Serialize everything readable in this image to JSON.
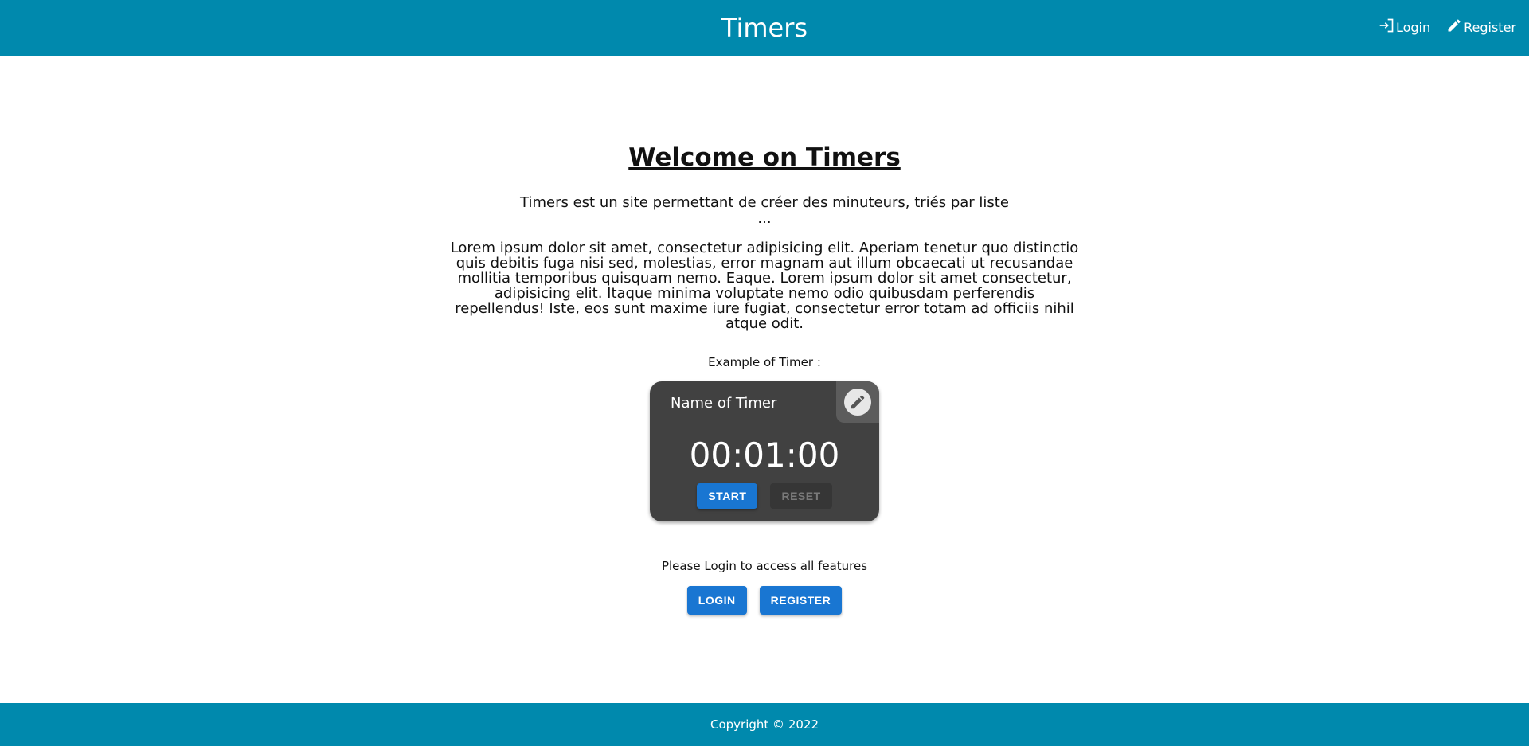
{
  "header": {
    "title": "Timers",
    "login_label": "Login",
    "register_label": "Register"
  },
  "main": {
    "welcome_title": "Welcome on Timers",
    "intro_line": "Timers est un site permettant de créer des minuteurs, triés par liste",
    "intro_ellipsis": "...",
    "lorem": "Lorem ipsum dolor sit amet, consectetur adipisicing elit. Aperiam tenetur quo distinctio quis debitis fuga nisi sed, molestias, error magnam aut illum obcaecati ut recusandae mollitia temporibus quisquam nemo. Eaque. Lorem ipsum dolor sit amet consectetur, adipisicing elit. Itaque minima voluptate nemo odio quibusdam perferendis repellendus! Iste, eos sunt maxime iure fugiat, consectetur error totam ad officiis nihil atque odit.",
    "example_label": "Example of Timer :",
    "timer": {
      "name": "Name of Timer",
      "time": "00:01:00",
      "start_label": "START",
      "reset_label": "RESET"
    },
    "login_prompt": "Please Login to access all features",
    "login_button": "LOGIN",
    "register_button": "REGISTER"
  },
  "footer": {
    "copyright": "Copyright © 2022"
  },
  "colors": {
    "brand": "#0089ad",
    "primary_button": "#1976d2",
    "timer_card": "#414141"
  },
  "icons": {
    "login": "login-icon",
    "register": "pencil-icon",
    "edit": "pencil-icon"
  }
}
